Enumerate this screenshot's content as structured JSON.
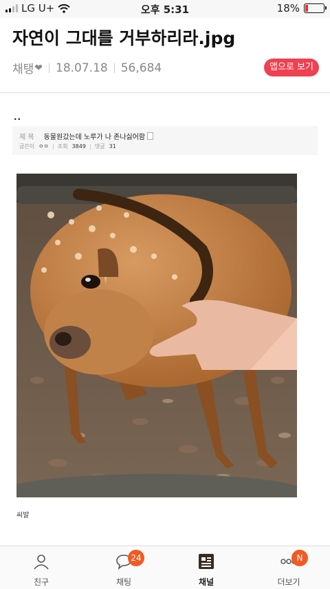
{
  "status_bar": {
    "carrier": "LG U+",
    "time": "오후 5:31",
    "battery": "18%",
    "battery_level": 0.18
  },
  "post": {
    "title": "자연이 그대를 거부하리라.jpg",
    "category": "채탱",
    "date": "18.07.18",
    "views": "56,684",
    "app_button": "앱으로 보기"
  },
  "body": {
    "dots": "..",
    "quote": {
      "title_label": "제 목",
      "title": "동물원갔는데 노루가 나 존나싫어함",
      "author_label": "글쓴이",
      "author": "ㅇㅇ",
      "views_label": "조회",
      "views": "3849",
      "comments_label": "댓글",
      "comments": "31"
    },
    "caption": "씨발"
  },
  "tabbar": {
    "tabs": [
      {
        "label": "친구",
        "icon": "person-icon",
        "badge": ""
      },
      {
        "label": "채팅",
        "icon": "chat-bubble-icon",
        "badge": "24"
      },
      {
        "label": "채널",
        "icon": "channel-icon",
        "badge": ""
      },
      {
        "label": "더보기",
        "icon": "more-icon",
        "badge": "N"
      }
    ],
    "active": 2,
    "badge_color": "#f15a22"
  },
  "colors": {
    "accent": "#ef4151",
    "badge": "#f15a22"
  }
}
